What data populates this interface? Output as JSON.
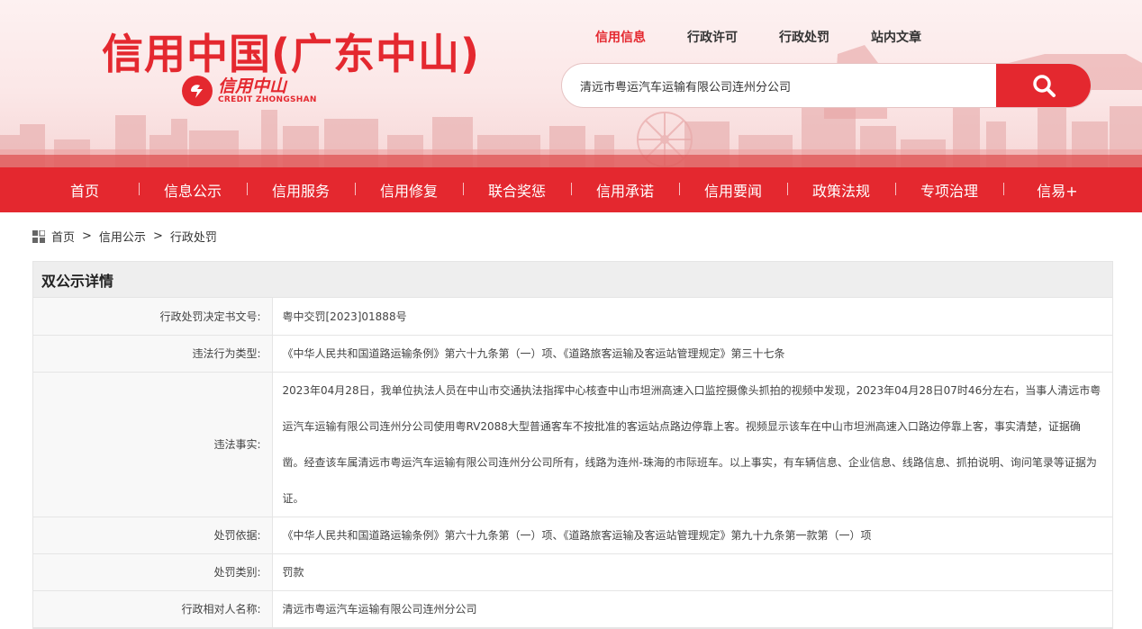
{
  "header": {
    "site_title": "信用中国(广东中山)",
    "logo_cn": "信用中山",
    "logo_en": "CREDIT ZHONGSHAN",
    "top_links": [
      "信用信息",
      "行政许可",
      "行政处罚",
      "站内文章"
    ],
    "search_value": "清远市粤运汽车运输有限公司连州分公司",
    "accent_color": "#e4282f"
  },
  "nav": {
    "items": [
      "首页",
      "信息公示",
      "信用服务",
      "信用修复",
      "联合奖惩",
      "信用承诺",
      "信用要闻",
      "政策法规",
      "专项治理",
      "信易+"
    ]
  },
  "breadcrumb": [
    "首页",
    "信用公示",
    "行政处罚"
  ],
  "detail": {
    "title": "双公示详情",
    "rows": [
      {
        "label": "行政处罚决定书文号:",
        "value": "粤中交罚[2023]01888号"
      },
      {
        "label": "违法行为类型:",
        "value": "《中华人民共和国道路运输条例》第六十九条第（一）项、《道路旅客运输及客运站管理规定》第三十七条"
      },
      {
        "label": "违法事实:",
        "value": "2023年04月28日，我单位执法人员在中山市交通执法指挥中心核查中山市坦洲高速入口监控摄像头抓拍的视频中发现，2023年04月28日07时46分左右，当事人清远市粤运汽车运输有限公司连州分公司使用粤RV2088大型普通客车不按批准的客运站点路边停靠上客。视频显示该车在中山市坦洲高速入口路边停靠上客，事实清楚，证据确凿。经查该车属清远市粤运汽车运输有限公司连州分公司所有，线路为连州-珠海的市际班车。以上事实，有车辆信息、企业信息、线路信息、抓拍说明、询问笔录等证据为证。"
      },
      {
        "label": "处罚依据:",
        "value": "《中华人民共和国道路运输条例》第六十九条第（一）项、《道路旅客运输及客运站管理规定》第九十九条第一款第（一）项"
      },
      {
        "label": "处罚类别:",
        "value": "罚款"
      },
      {
        "label": "行政相对人名称:",
        "value": "清远市粤运汽车运输有限公司连州分公司"
      }
    ]
  }
}
